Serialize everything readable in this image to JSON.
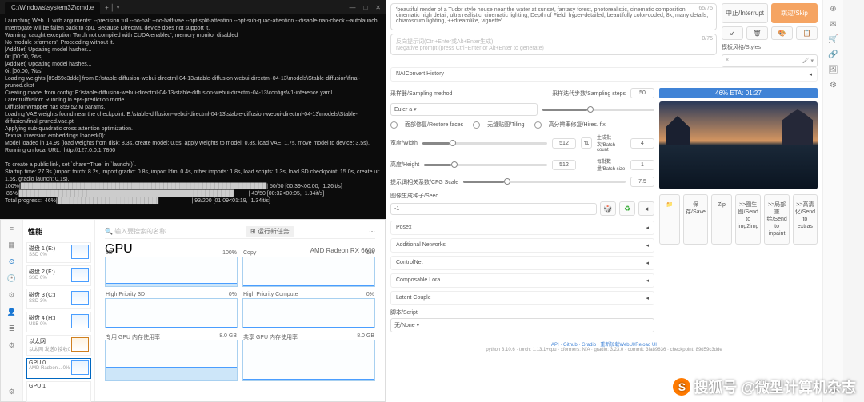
{
  "terminal": {
    "title": "C:\\Windows\\system32\\cmd.e",
    "body": "Launching Web UI with arguments: --precision full --no-half --no-half-vae --opt-split-attention --opt-sub-quad-attention --disable-nan-check --autolaunch\nInterrogate will be fallen back to cpu. Because DirectML device does not support it.\nWarning: caught exception 'Torch not compiled with CUDA enabled', memory monitor disabled\nNo module 'xformers'. Proceeding without it.\n[AddNet] Updating model hashes...\n0it [00:00, ?it/s]\n[AddNet] Updating model hashes...\n0it [00:00, ?it/s]\nLoading weights [89d59c3dde] from E:\\stable-diffusion-webui-directml-04-13\\stable-diffusion-webui-directml-04-13\\models\\Stable-diffusion\\final-pruned.ckpt\nCreating model from config: E:\\stable-diffusion-webui-directml-04-13\\stable-diffusion-webui-directml-04-13\\configs\\v1-inference.yaml\nLatentDiffusion: Running in eps-prediction mode\nDiffusionWrapper has 859.52 M params.\nLoading VAE weights found near the checkpoint: E:\\stable-diffusion-webui-directml-04-13\\stable-diffusion-webui-directml-04-13\\models\\Stable-diffusion\\final-pruned.vae.pt\nApplying sub-quadratic cross attention optimization.\nTextual inversion embeddings loaded(0):\nModel loaded in 14.9s (load weights from disk: 8.3s, create model: 0.5s, apply weights to model: 0.8s, load VAE: 1.7s, move model to device: 3.5s).\nRunning on local URL:  http://127.0.0.1:7860\n\nTo create a public link, set `share=True` in `launch()`.\nStartup time: 27.3s (import torch: 8.2s, import gradio: 0.8s, import ldm: 0.4s, other imports: 1.8s, load scripts: 1.3s, load SD checkpoint: 15.0s, create ui: 1.6s, gradio launch: 0.1s).\n100%|██████████████████████████████████████████████████████████████| 50/50 [00:39<00:00,  1.26it/s]\n 86%|██████████████████████████████████████████████████████▏       | 43/50 [00:32<00:05,  1.34it/s]\nTotal progress:  46%|█████████████████████████▌                    | 93/200 [01:09<01:19,  1.34it/s]"
  },
  "taskmgr": {
    "header": "性能",
    "run": "⊞ 运行新任务",
    "gpu_title": "GPU",
    "gpu_name": "AMD Radeon RX 6600",
    "charts": {
      "c3d": {
        "tl": "3D",
        "tr": "100%"
      },
      "copy": {
        "tl": "Copy",
        "tr": "1%"
      },
      "hp3d": {
        "tl": "High Priority 3D",
        "tr": "0%"
      },
      "hpc": {
        "tl": "High Priority Compute",
        "tr": "0%"
      },
      "vram": {
        "tl": "专用 GPU 内存使用率",
        "tr": "8.0 GB"
      },
      "shared": {
        "tl": "共享 GPU 内存使用率",
        "tr": "8.0 GB"
      }
    },
    "side": [
      {
        "lbl": "磁盘 1 (E:)",
        "sub": "SSD  0%"
      },
      {
        "lbl": "磁盘 2 (F:)",
        "sub": "SSD  0%"
      },
      {
        "lbl": "磁盘 3 (C:)",
        "sub": "SSD  3%"
      },
      {
        "lbl": "磁盘 4 (H:)",
        "sub": "USB  0%"
      },
      {
        "lbl": "以太网",
        "sub": "以太网  发送0  接收0  Kbp"
      },
      {
        "lbl": "GPU 0",
        "sub": "AMD Radeon...  0% (4%)"
      },
      {
        "lbl": "GPU 1",
        "sub": ""
      }
    ]
  },
  "webui": {
    "prompt": "'beautiful render of a Tudor style house near the water at\nsunset, fantasy forest, photorealistic, cinematic composition, cinematic high detail, ultra realistic, cinematic lighting, Depth of Field, hyper-detailed, beautifully color-coded, 8k, many details, chiaroscuro lighting, ++dreamlike, vignette'",
    "prompt_count": "65/75",
    "neg_placeholder": "反向提示词(Ctrl+Enter或Alt+Enter生成)\nNegative prompt (press Ctrl+Enter or Alt+Enter to generate)",
    "neg_count": "0/75",
    "interrupt": "中止/Interrupt",
    "skip": "跳过/Skip",
    "styles_label": "模板风格/Styles",
    "styles_value": "×",
    "history": "NAIConvert History",
    "sampler_label": "采样器/Sampling method",
    "sampler_value": "Euler a",
    "steps_label": "采样迭代步数/Sampling steps",
    "steps_value": "50",
    "restore": "面部修复/Restore faces",
    "tiling": "无缝贴图/Tiling",
    "hires": "高分辨率修复/Hires. fix",
    "width_label": "宽度/Width",
    "width_value": "512",
    "height_label": "高度/Height",
    "height_value": "512",
    "batch_count_label": "生成批次/Batch count",
    "batch_count_value": "4",
    "batch_size_label": "每批数量/Batch size",
    "batch_size_value": "1",
    "cfg_label": "提示词相关系数/CFG Scale",
    "cfg_value": "7.5",
    "seed_label": "图像生成种子/Seed",
    "seed_value": "-1",
    "accordions": [
      "Posex",
      "Additional Networks",
      "ControlNet",
      "Composable Lora",
      "Latent Couple"
    ],
    "script_label": "脚本/Script",
    "script_value": "无/None",
    "progress": "46% ETA: 01:27",
    "out_btns": [
      {
        "l": "📁"
      },
      {
        "l": "保存/Save"
      },
      {
        "l": "Zip"
      },
      {
        "l": ">>图生图/Send to img2img"
      },
      {
        "l": ">>局部重绘/Send to inpaint"
      },
      {
        "l": ">>高清化/Send to extras"
      }
    ],
    "footer_links": "API · Github · Gradio · 重新加载WebUI/Reload UI",
    "footer_ver": "python 3.10.6 · torch: 1.13.1+cpu · xformers: N/A · gradio: 3.23.0 · commit: 3fa89636 · checkpoint: 89d59c3dde"
  },
  "watermark": "搜狐号 @微型计算机杂志"
}
